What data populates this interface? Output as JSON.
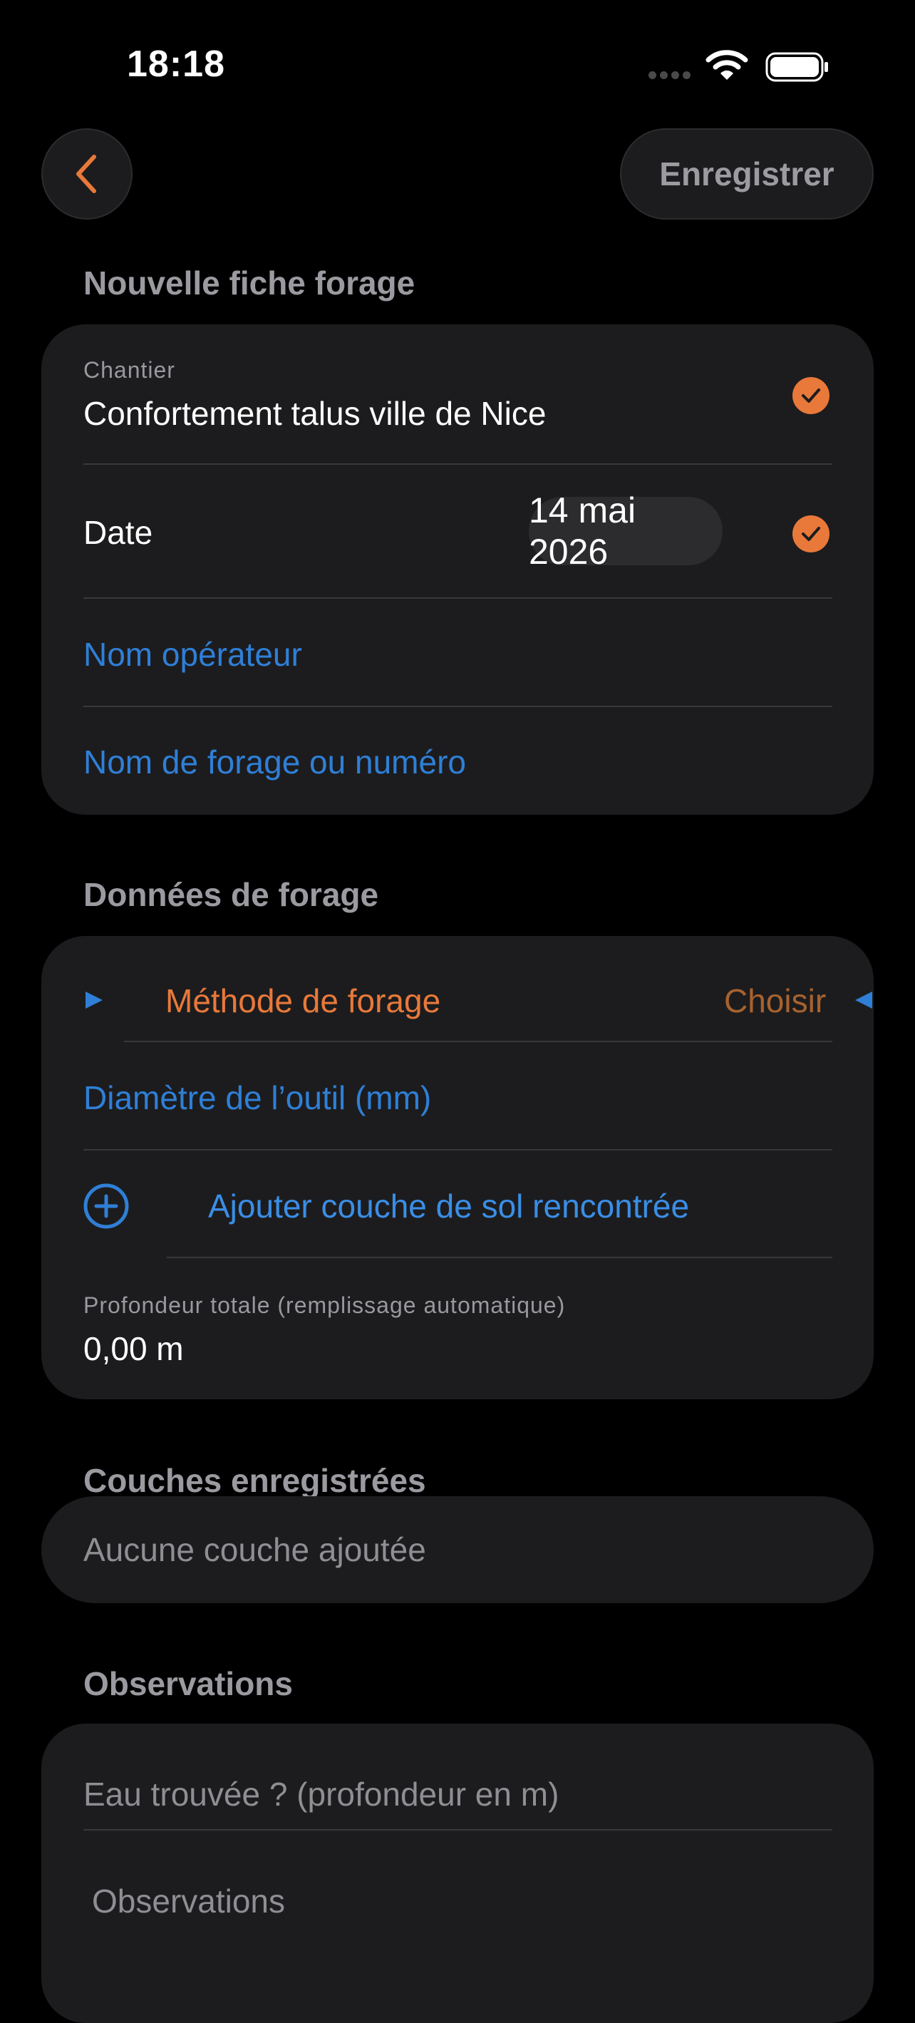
{
  "status_bar": {
    "time": "18:18"
  },
  "nav": {
    "save_label": "Enregistrer"
  },
  "section_new": {
    "title": "Nouvelle fiche forage",
    "chantier_label": "Chantier",
    "chantier_value": "Confortement talus ville de Nice",
    "date_label": "Date",
    "date_value": "14 mai 2026",
    "operator_placeholder": "Nom opérateur",
    "borehole_placeholder": "Nom de forage ou numéro"
  },
  "section_data": {
    "title": "Données de forage",
    "method_label": "Méthode de forage",
    "method_value": "Choisir",
    "diameter_placeholder": "Diamètre de l’outil (mm)",
    "add_layer_label": "Ajouter couche de sol rencontrée",
    "depth_label": "Profondeur totale (remplissage automatique)",
    "depth_value": "0,00 m"
  },
  "section_layers": {
    "title": "Couches enregistrées",
    "empty_text": "Aucune couche ajoutée"
  },
  "section_obs": {
    "title": "Observations",
    "water_placeholder": "Eau trouvée ? (profondeur en m)",
    "observations_placeholder": "Observations"
  },
  "colors": {
    "accent_orange": "#e8793a",
    "link_blue": "#2f7fd6",
    "card_bg": "#1c1c1e"
  }
}
